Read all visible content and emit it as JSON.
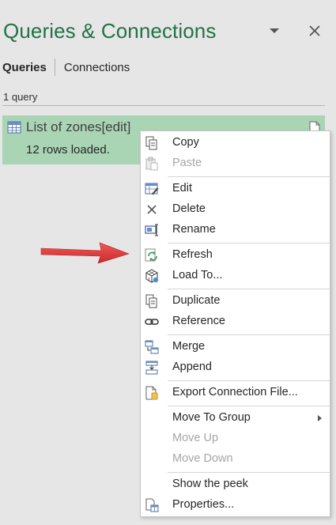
{
  "pane": {
    "title": "Queries & Connections",
    "tabs": [
      {
        "label": "Queries",
        "active": true
      },
      {
        "label": "Connections",
        "active": false
      }
    ],
    "query_count": "1 query",
    "query": {
      "name": "List of zones[edit]",
      "status": "12 rows loaded."
    }
  },
  "context_menu": {
    "items": [
      {
        "label": "Copy",
        "icon": "copy-icon",
        "enabled": true
      },
      {
        "label": "Paste",
        "icon": "paste-icon",
        "enabled": false
      },
      {
        "label": "Edit",
        "icon": "edit-table-icon",
        "enabled": true
      },
      {
        "label": "Delete",
        "icon": "x-icon",
        "enabled": true
      },
      {
        "label": "Rename",
        "icon": "rename-icon",
        "enabled": true
      },
      {
        "label": "Refresh",
        "icon": "refresh-icon",
        "enabled": true
      },
      {
        "label": "Load To...",
        "icon": "load-cube-icon",
        "enabled": true
      },
      {
        "label": "Duplicate",
        "icon": "duplicate-icon",
        "enabled": true
      },
      {
        "label": "Reference",
        "icon": "link-icon",
        "enabled": true
      },
      {
        "label": "Merge",
        "icon": "merge-icon",
        "enabled": true
      },
      {
        "label": "Append",
        "icon": "append-icon",
        "enabled": true
      },
      {
        "label": "Export Connection File...",
        "icon": "export-file-icon",
        "enabled": true
      },
      {
        "label": "Move To Group",
        "icon": "",
        "enabled": true,
        "submenu": true
      },
      {
        "label": "Move Up",
        "icon": "",
        "enabled": false
      },
      {
        "label": "Move Down",
        "icon": "",
        "enabled": false
      },
      {
        "label": "Show the peek",
        "icon": "",
        "enabled": true
      },
      {
        "label": "Properties...",
        "icon": "properties-icon",
        "enabled": true
      }
    ]
  },
  "colors": {
    "title_green": "#217346",
    "selected_query_bg": "#a9d5b4",
    "arrow_red": "#e03c3c",
    "pane_bg": "#e6e6e6",
    "disabled_text": "#a6a6a6"
  }
}
